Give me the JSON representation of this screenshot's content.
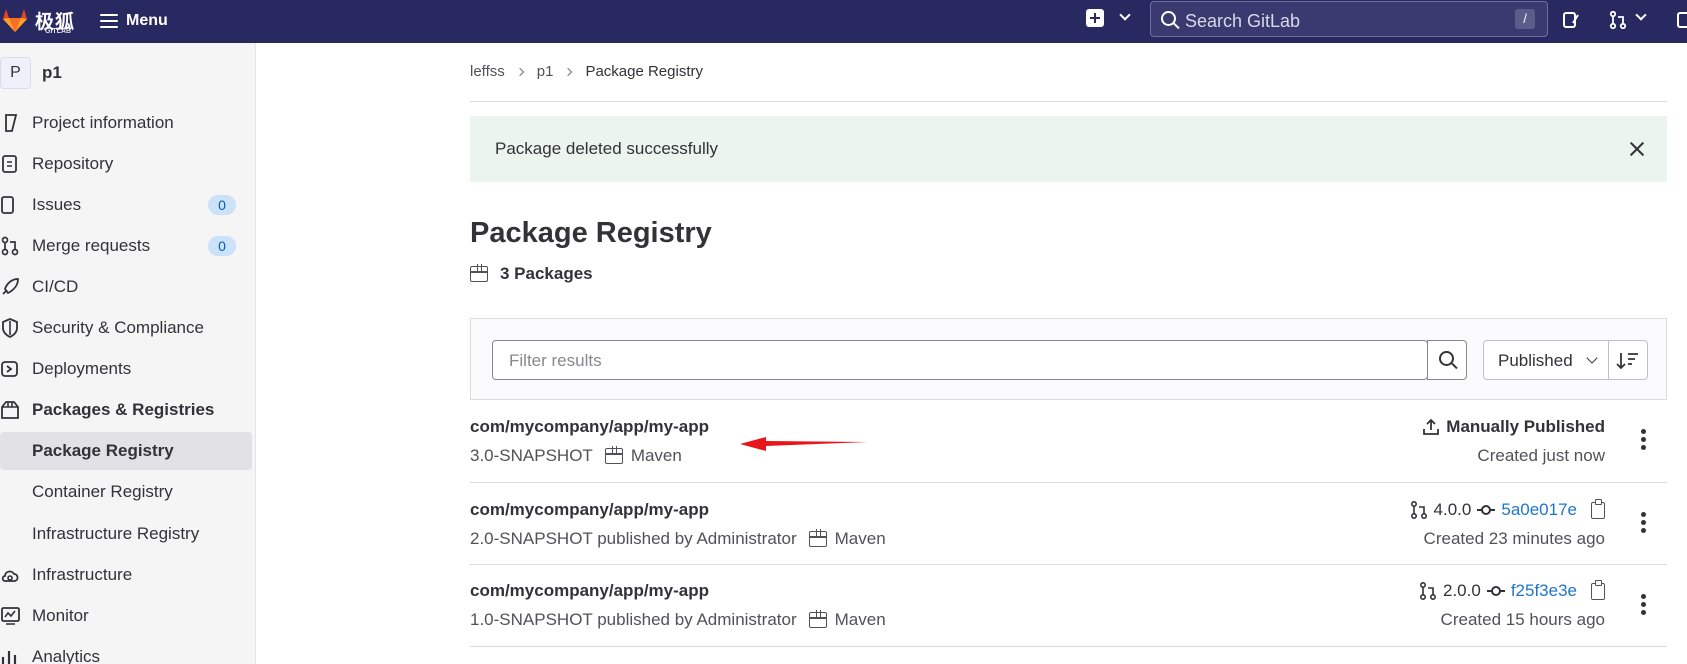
{
  "topbar": {
    "logo_text": "极狐",
    "logo_sub": "GITLAB",
    "menu_label": "Menu",
    "search_placeholder": "Search GitLab",
    "search_shortcut": "/"
  },
  "sidebar": {
    "project_avatar": "P",
    "project_name": "p1",
    "items": [
      {
        "label": "Project information",
        "icon": "info-icon"
      },
      {
        "label": "Repository",
        "icon": "document-icon"
      },
      {
        "label": "Issues",
        "icon": "issues-icon",
        "count": "0"
      },
      {
        "label": "Merge requests",
        "icon": "merge-request-icon",
        "count": "0"
      },
      {
        "label": "CI/CD",
        "icon": "rocket-icon"
      },
      {
        "label": "Security & Compliance",
        "icon": "shield-icon"
      },
      {
        "label": "Deployments",
        "icon": "deployments-icon"
      },
      {
        "label": "Packages & Registries",
        "icon": "package-icon"
      },
      {
        "label": "Package Registry"
      },
      {
        "label": "Container Registry"
      },
      {
        "label": "Infrastructure Registry"
      },
      {
        "label": "Infrastructure",
        "icon": "cloud-gear-icon"
      },
      {
        "label": "Monitor",
        "icon": "monitor-icon"
      },
      {
        "label": "Analytics",
        "icon": "chart-icon"
      }
    ]
  },
  "breadcrumb": [
    "leffss",
    "p1",
    "Package Registry"
  ],
  "alert": {
    "text": "Package deleted successfully"
  },
  "page": {
    "title": "Package Registry",
    "package_count": "3 Packages"
  },
  "filter": {
    "placeholder": "Filter results",
    "sort_label": "Published"
  },
  "packages": [
    {
      "name": "com/mycompany/app/my-app",
      "version": "3.0-SNAPSHOT",
      "type": "Maven",
      "published_by": "",
      "status": "Manually Published",
      "created": "Created just now"
    },
    {
      "name": "com/mycompany/app/my-app",
      "version": "2.0-SNAPSHOT published by Administrator",
      "type": "Maven",
      "pipeline_ref": "4.0.0",
      "commit": "5a0e017e",
      "created": "Created 23 minutes ago"
    },
    {
      "name": "com/mycompany/app/my-app",
      "version": "1.0-SNAPSHOT published by Administrator",
      "type": "Maven",
      "pipeline_ref": "2.0.0",
      "commit": "f25f3e3e",
      "created": "Created 15 hours ago"
    }
  ],
  "colors": {
    "topbar": "#292961",
    "alert_bg": "#ecf4ee",
    "link": "#1f75cb",
    "annotation_arrow": "#e8161b"
  }
}
